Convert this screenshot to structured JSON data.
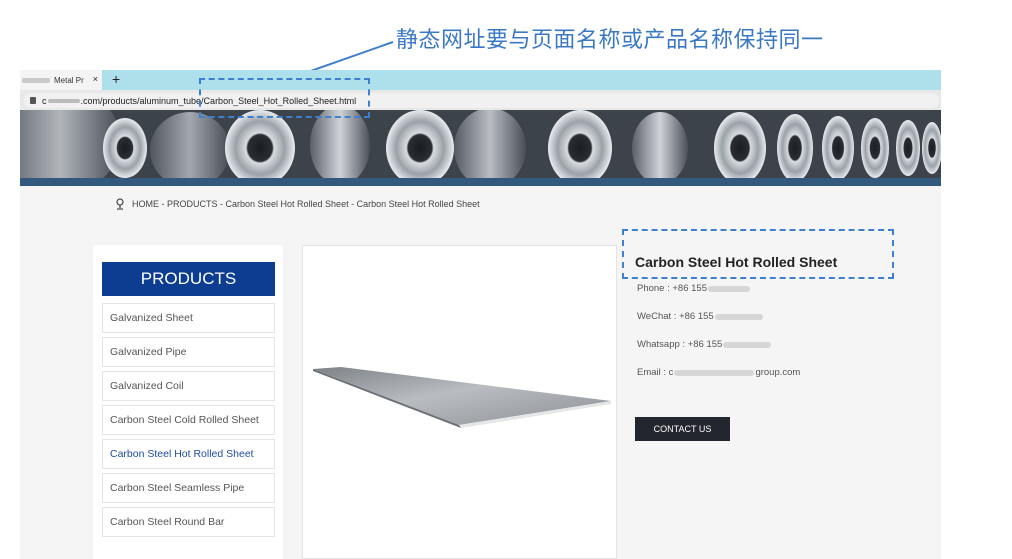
{
  "annotation": {
    "text": "静态网址要与页面名称或产品名称保持同一",
    "color": "#3a78c6"
  },
  "browser": {
    "tab_title": "Metal Pr",
    "new_tab_symbol": "+",
    "close_symbol": "×",
    "url_prefix": "c",
    "url_rest": ".com/products/aluminum_tube/Carbon_Steel_Hot_Rolled_Sheet.html"
  },
  "breadcrumb": {
    "text": "HOME - PRODUCTS - Carbon Steel Hot Rolled Sheet - Carbon Steel Hot Rolled Sheet"
  },
  "sidebar": {
    "heading": "PRODUCTS",
    "items": [
      {
        "label": "Galvanized Sheet"
      },
      {
        "label": "Galvanized Pipe"
      },
      {
        "label": "Galvanized Coil"
      },
      {
        "label": "Carbon Steel Cold Rolled Sheet"
      },
      {
        "label": "Carbon Steel Hot Rolled Sheet"
      },
      {
        "label": "Carbon Steel Seamless Pipe"
      },
      {
        "label": "Carbon Steel Round Bar"
      }
    ],
    "active_index": 4
  },
  "product": {
    "title": "Carbon Steel Hot Rolled Sheet",
    "phone_label": "Phone : +86 155",
    "wechat_label": "WeChat : +86 155",
    "whatsapp_label": "Whatsapp : +86 155",
    "email_prefix": "Email : c",
    "email_suffix": "group.com",
    "contact_button": "CONTACT US"
  },
  "colors": {
    "brand_blue": "#0c3d91",
    "annotation_blue": "#3d7fd1",
    "button_dark": "#23262e",
    "tabbar": "#aee0ec"
  }
}
